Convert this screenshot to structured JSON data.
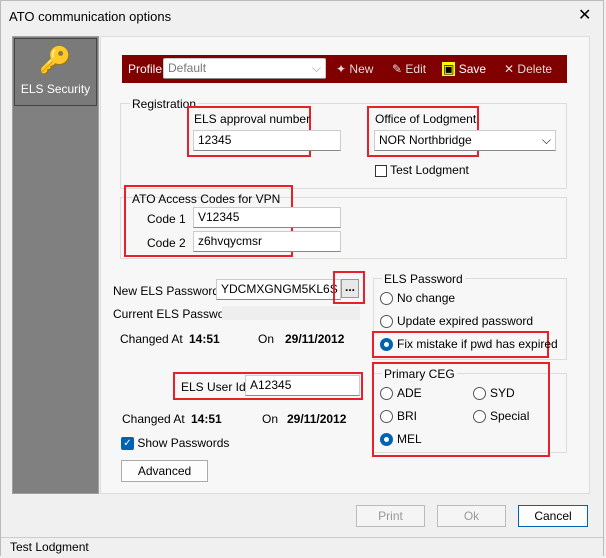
{
  "window": {
    "title": "ATO communication options"
  },
  "sidebar": {
    "items": [
      {
        "label": "ELS Security",
        "icon": "key-document-icon"
      }
    ]
  },
  "profile": {
    "label": "Profile",
    "value": "Default",
    "new": "New",
    "edit": "Edit",
    "save": "Save",
    "delete": "Delete"
  },
  "registration": {
    "label": "Registration",
    "approval_label": "ELS approval number",
    "approval_value": "12345",
    "office_label": "Office of Lodgment",
    "office_value": "NOR Northbridge",
    "test_lodgment": "Test Lodgment"
  },
  "vpn": {
    "label": "ATO Access Codes for VPN",
    "code1_label": "Code 1",
    "code1": "V12345",
    "code2_label": "Code 2",
    "code2": "z6hvqycmsr"
  },
  "password": {
    "new_label": "New ELS Password",
    "new_value": "YDCMXGNGM5KL6S",
    "browse": "...",
    "current_label": "Current ELS Password",
    "changed_at_label": "Changed At",
    "changed_at": "14:51",
    "on_label": "On",
    "on": "29/11/2012"
  },
  "user": {
    "label": "ELS User Id",
    "value": "A12345",
    "changed_at_label": "Changed At",
    "changed_at": "14:51",
    "on_label": "On",
    "on": "29/11/2012"
  },
  "show_passwords": "Show Passwords",
  "advanced": "Advanced",
  "els_password_group": {
    "label": "ELS Password",
    "options": [
      "No change",
      "Update expired password",
      "Fix mistake if pwd has expired"
    ],
    "selected": 2
  },
  "ceg": {
    "label": "Primary CEG",
    "options": [
      "ADE",
      "SYD",
      "BRI",
      "Special",
      "MEL"
    ],
    "selected": "MEL"
  },
  "buttons": {
    "print": "Print",
    "ok": "Ok",
    "cancel": "Cancel"
  },
  "status": "Test Lodgment",
  "colors": {
    "profile_bar": "#800000",
    "highlight": "#e8202a",
    "accent": "#0063b1"
  }
}
